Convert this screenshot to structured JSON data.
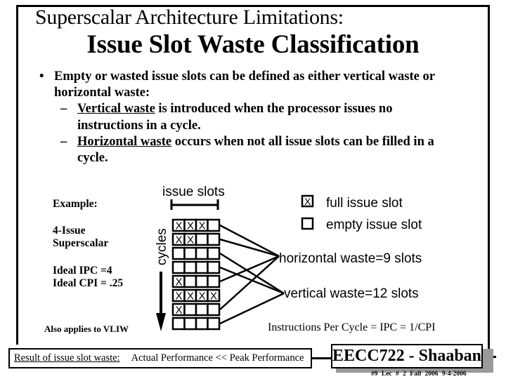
{
  "slide": {
    "title_line1": "Superscalar Architecture Limitations:",
    "title_line2": "Issue Slot Waste Classification",
    "bullet": {
      "marker": "•",
      "line1": "Empty or wasted issue slots can be defined as either vertical waste or",
      "line2": "horizontal waste:",
      "subs": [
        {
          "marker": "–",
          "term": "Vertical waste",
          "rest1": " is introduced when the processor issues no",
          "rest2": "instructions in a cycle."
        },
        {
          "marker": "–",
          "term": "Horizontal waste",
          "rest1": " occurs when not all issue slots can be filled in a",
          "rest2": "cycle."
        }
      ]
    },
    "example": {
      "label": "Example:",
      "machine_line1": "4-Issue",
      "machine_line2": "Superscalar",
      "ideal_ipc": "Ideal IPC =4",
      "ideal_cpi": "Ideal CPI = .25"
    },
    "diagram": {
      "issue_slots_label": "issue slots",
      "cycles_label": "cycles",
      "slot_mark": "X",
      "rows": [
        {
          "slots": [
            true,
            true,
            true,
            false
          ],
          "waste": "horizontal"
        },
        {
          "slots": [
            true,
            true,
            false,
            false
          ],
          "waste": "horizontal"
        },
        {
          "slots": [
            false,
            false,
            false,
            false
          ],
          "waste": "vertical"
        },
        {
          "slots": [
            false,
            false,
            false,
            false
          ],
          "waste": "vertical"
        },
        {
          "slots": [
            true,
            false,
            false,
            false
          ],
          "waste": "horizontal"
        },
        {
          "slots": [
            true,
            true,
            true,
            true
          ],
          "waste": "none"
        },
        {
          "slots": [
            true,
            false,
            false,
            false
          ],
          "waste": "horizontal"
        },
        {
          "slots": [
            false,
            false,
            false,
            false
          ],
          "waste": "vertical"
        }
      ],
      "legend": {
        "full_mark": "X",
        "full_label": "full issue slot",
        "empty_label": "empty issue slot"
      },
      "horizontal_waste": {
        "label": "horizontal waste",
        "eq": "=",
        "value": "9 slots"
      },
      "vertical_waste": {
        "label": "vertical waste",
        "eq": "=",
        "value": "12 slots"
      }
    },
    "also_applies": "Also applies to VLIW",
    "ipc_formula": "Instructions Per Cycle = IPC = 1/CPI",
    "result": {
      "label": "Result of issue slot waste:",
      "value": "Actual Performance << Peak Performance"
    },
    "course_badge": "EECC722 - Shaaban",
    "footer": "#9   Lec # 2   Fall 2006  9-4-2006"
  }
}
